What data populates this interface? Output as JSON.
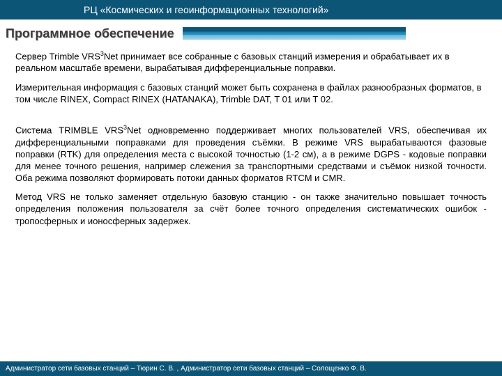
{
  "header": {
    "title": "РЦ «Космических и геоинформационных технологий»"
  },
  "subtitle": "Программное обеспечение",
  "paragraphs": {
    "p1a": "Сервер Trimble VRS",
    "p1sup": "3",
    "p1b": "Net принимает все собранные с базовых станций измерения и обрабатывает их в реальном масштабе времени, вырабатывая дифференциальные поправки.",
    "p2": "Измерительная информация с базовых станций может быть сохранена в файлах разнообразных форматов, в том числе RINEX, Compact RINEX (HATANAKA), Trimble DAT, T 01 или T 02.",
    "p3a": "Система TRIMBLE VRS",
    "p3sup": "3",
    "p3b": "Net одновременно поддерживает многих пользователей VRS, обеспечивая их дифференциальными поправками для проведения съёмки. В режиме VRS вырабатываются фазовые поправки (RTK) для определения места с высокой точностью (1-2 см), а в режиме DGPS - кодовые поправки для менее точного решения, например слежения за транспортными средствами и съёмок низкой точности. Оба режима позволяют формировать потоки данных форматов RTCM и CMR.",
    "p4": "Метод VRS не только заменяет отдельную базовую станцию - он также значительно повышает точность определения положения пользователя за счёт более точного определения систематических ошибок - тропосферных и ионосферных задержек."
  },
  "footer": {
    "text": "Администратор сети базовых станций – Тюрин С. В. ,  Администратор сети базовых станций – Солощенко Ф. В."
  }
}
